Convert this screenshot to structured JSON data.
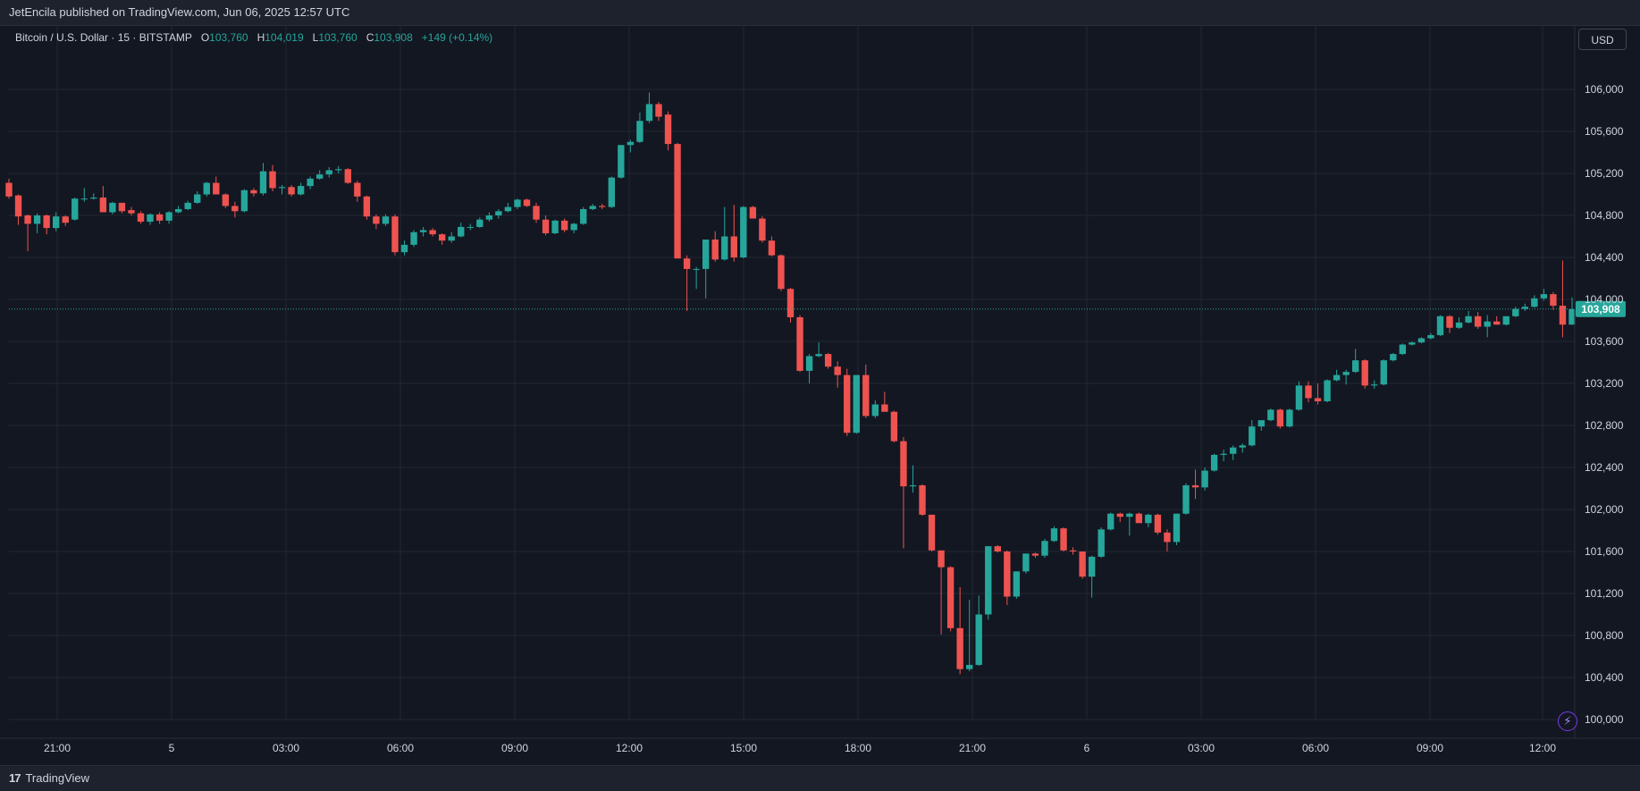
{
  "header": {
    "published": "JetEncila published on TradingView.com, Jun 06, 2025 12:57 UTC"
  },
  "legend": {
    "symbol": "Bitcoin / U.S. Dollar · 15 · BITSTAMP",
    "o_label": "O",
    "o_value": "103,760",
    "h_label": "H",
    "h_value": "104,019",
    "l_label": "L",
    "l_value": "103,760",
    "c_label": "C",
    "c_value": "103,908",
    "change": "+149 (+0.14%)"
  },
  "currency_button": "USD",
  "footer": {
    "brand": "TradingView",
    "logo_icon": "tradingview-logo-icon"
  },
  "colors": {
    "up": "#26a69a",
    "down": "#ef5350",
    "background": "#131722",
    "grid": "#232733"
  },
  "chart_data": {
    "type": "candlestick",
    "symbol": "BTCUSD",
    "interval_minutes": 15,
    "y_ticks": [
      100000,
      100400,
      100800,
      101200,
      101600,
      102000,
      102400,
      102800,
      103200,
      103600,
      104000,
      104400,
      104800,
      105200,
      105600,
      106000
    ],
    "y_tick_labels": [
      "100,000",
      "100,400",
      "100,800",
      "101,200",
      "101,600",
      "102,000",
      "102,400",
      "102,800",
      "103,200",
      "103,600",
      "104,000",
      "104,400",
      "104,800",
      "105,200",
      "105,600",
      "106,000"
    ],
    "x_tick_labels": [
      "21:00",
      "5",
      "03:00",
      "06:00",
      "09:00",
      "12:00",
      "15:00",
      "18:00",
      "21:00",
      "6",
      "03:00",
      "06:00",
      "09:00",
      "12:00"
    ],
    "last_price": 103908,
    "last_price_label": "103,908",
    "ylim": [
      99900,
      106300
    ],
    "candles": [
      {
        "o": 105110,
        "h": 105150,
        "l": 104960,
        "c": 104980
      },
      {
        "o": 104990,
        "h": 105000,
        "l": 104710,
        "c": 104790
      },
      {
        "o": 104800,
        "h": 104810,
        "l": 104460,
        "c": 104720
      },
      {
        "o": 104720,
        "h": 104820,
        "l": 104630,
        "c": 104800
      },
      {
        "o": 104800,
        "h": 104810,
        "l": 104620,
        "c": 104680
      },
      {
        "o": 104680,
        "h": 104830,
        "l": 104650,
        "c": 104790
      },
      {
        "o": 104790,
        "h": 104800,
        "l": 104700,
        "c": 104730
      },
      {
        "o": 104760,
        "h": 104970,
        "l": 104750,
        "c": 104960
      },
      {
        "o": 104960,
        "h": 105060,
        "l": 104930,
        "c": 104960
      },
      {
        "o": 104960,
        "h": 105010,
        "l": 104950,
        "c": 104970
      },
      {
        "o": 104970,
        "h": 105080,
        "l": 104830,
        "c": 104830
      },
      {
        "o": 104830,
        "h": 104930,
        "l": 104810,
        "c": 104920
      },
      {
        "o": 104920,
        "h": 104920,
        "l": 104820,
        "c": 104840
      },
      {
        "o": 104850,
        "h": 104880,
        "l": 104800,
        "c": 104820
      },
      {
        "o": 104820,
        "h": 104840,
        "l": 104720,
        "c": 104740
      },
      {
        "o": 104740,
        "h": 104820,
        "l": 104710,
        "c": 104810
      },
      {
        "o": 104810,
        "h": 104830,
        "l": 104720,
        "c": 104750
      },
      {
        "o": 104750,
        "h": 104840,
        "l": 104720,
        "c": 104830
      },
      {
        "o": 104830,
        "h": 104890,
        "l": 104820,
        "c": 104860
      },
      {
        "o": 104860,
        "h": 104940,
        "l": 104850,
        "c": 104920
      },
      {
        "o": 104920,
        "h": 105030,
        "l": 104910,
        "c": 105000
      },
      {
        "o": 105000,
        "h": 105120,
        "l": 104980,
        "c": 105110
      },
      {
        "o": 105110,
        "h": 105170,
        "l": 105000,
        "c": 105000
      },
      {
        "o": 105000,
        "h": 105010,
        "l": 104870,
        "c": 104890
      },
      {
        "o": 104890,
        "h": 104930,
        "l": 104780,
        "c": 104840
      },
      {
        "o": 104840,
        "h": 105050,
        "l": 104830,
        "c": 105040
      },
      {
        "o": 105040,
        "h": 105060,
        "l": 104980,
        "c": 105010
      },
      {
        "o": 105010,
        "h": 105300,
        "l": 104990,
        "c": 105220
      },
      {
        "o": 105220,
        "h": 105280,
        "l": 105030,
        "c": 105060
      },
      {
        "o": 105060,
        "h": 105090,
        "l": 105000,
        "c": 105070
      },
      {
        "o": 105070,
        "h": 105090,
        "l": 104980,
        "c": 105000
      },
      {
        "o": 105000,
        "h": 105110,
        "l": 104990,
        "c": 105080
      },
      {
        "o": 105080,
        "h": 105170,
        "l": 105050,
        "c": 105150
      },
      {
        "o": 105150,
        "h": 105230,
        "l": 105140,
        "c": 105190
      },
      {
        "o": 105190,
        "h": 105260,
        "l": 105160,
        "c": 105230
      },
      {
        "o": 105230,
        "h": 105270,
        "l": 105200,
        "c": 105240
      },
      {
        "o": 105240,
        "h": 105250,
        "l": 105100,
        "c": 105110
      },
      {
        "o": 105110,
        "h": 105130,
        "l": 104930,
        "c": 104980
      },
      {
        "o": 104980,
        "h": 104990,
        "l": 104760,
        "c": 104790
      },
      {
        "o": 104790,
        "h": 104810,
        "l": 104670,
        "c": 104720
      },
      {
        "o": 104720,
        "h": 104810,
        "l": 104700,
        "c": 104790
      },
      {
        "o": 104790,
        "h": 104810,
        "l": 104420,
        "c": 104450
      },
      {
        "o": 104450,
        "h": 104560,
        "l": 104420,
        "c": 104520
      },
      {
        "o": 104520,
        "h": 104660,
        "l": 104500,
        "c": 104640
      },
      {
        "o": 104640,
        "h": 104690,
        "l": 104600,
        "c": 104660
      },
      {
        "o": 104660,
        "h": 104680,
        "l": 104600,
        "c": 104620
      },
      {
        "o": 104620,
        "h": 104630,
        "l": 104520,
        "c": 104560
      },
      {
        "o": 104560,
        "h": 104640,
        "l": 104540,
        "c": 104600
      },
      {
        "o": 104600,
        "h": 104730,
        "l": 104590,
        "c": 104690
      },
      {
        "o": 104690,
        "h": 104720,
        "l": 104660,
        "c": 104690
      },
      {
        "o": 104690,
        "h": 104780,
        "l": 104680,
        "c": 104760
      },
      {
        "o": 104760,
        "h": 104830,
        "l": 104740,
        "c": 104800
      },
      {
        "o": 104800,
        "h": 104860,
        "l": 104770,
        "c": 104840
      },
      {
        "o": 104840,
        "h": 104920,
        "l": 104830,
        "c": 104880
      },
      {
        "o": 104880,
        "h": 104960,
        "l": 104860,
        "c": 104950
      },
      {
        "o": 104950,
        "h": 104960,
        "l": 104880,
        "c": 104890
      },
      {
        "o": 104890,
        "h": 104920,
        "l": 104730,
        "c": 104760
      },
      {
        "o": 104760,
        "h": 104800,
        "l": 104610,
        "c": 104630
      },
      {
        "o": 104630,
        "h": 104760,
        "l": 104620,
        "c": 104750
      },
      {
        "o": 104750,
        "h": 104770,
        "l": 104640,
        "c": 104660
      },
      {
        "o": 104660,
        "h": 104730,
        "l": 104630,
        "c": 104720
      },
      {
        "o": 104720,
        "h": 104880,
        "l": 104710,
        "c": 104860
      },
      {
        "o": 104860,
        "h": 104910,
        "l": 104850,
        "c": 104890
      },
      {
        "o": 104890,
        "h": 104910,
        "l": 104860,
        "c": 104880
      },
      {
        "o": 104880,
        "h": 105170,
        "l": 104870,
        "c": 105160
      },
      {
        "o": 105160,
        "h": 105470,
        "l": 105150,
        "c": 105470
      },
      {
        "o": 105470,
        "h": 105520,
        "l": 105400,
        "c": 105500
      },
      {
        "o": 105500,
        "h": 105780,
        "l": 105490,
        "c": 105700
      },
      {
        "o": 105700,
        "h": 105970,
        "l": 105680,
        "c": 105860
      },
      {
        "o": 105860,
        "h": 105880,
        "l": 105700,
        "c": 105740
      },
      {
        "o": 105760,
        "h": 105790,
        "l": 105420,
        "c": 105480
      },
      {
        "o": 105480,
        "h": 105490,
        "l": 104390,
        "c": 104390
      },
      {
        "o": 104390,
        "h": 104420,
        "l": 103890,
        "c": 104290
      },
      {
        "o": 104290,
        "h": 104310,
        "l": 104100,
        "c": 104290
      },
      {
        "o": 104290,
        "h": 104570,
        "l": 104010,
        "c": 104570
      },
      {
        "o": 104570,
        "h": 104650,
        "l": 104360,
        "c": 104380
      },
      {
        "o": 104380,
        "h": 104880,
        "l": 104370,
        "c": 104600
      },
      {
        "o": 104600,
        "h": 104900,
        "l": 104360,
        "c": 104400
      },
      {
        "o": 104400,
        "h": 104890,
        "l": 104390,
        "c": 104880
      },
      {
        "o": 104880,
        "h": 104890,
        "l": 104770,
        "c": 104770
      },
      {
        "o": 104770,
        "h": 104790,
        "l": 104540,
        "c": 104560
      },
      {
        "o": 104560,
        "h": 104600,
        "l": 104410,
        "c": 104420
      },
      {
        "o": 104420,
        "h": 104430,
        "l": 104080,
        "c": 104100
      },
      {
        "o": 104100,
        "h": 104110,
        "l": 103780,
        "c": 103830
      },
      {
        "o": 103830,
        "h": 103850,
        "l": 103310,
        "c": 103320
      },
      {
        "o": 103320,
        "h": 103480,
        "l": 103200,
        "c": 103460
      },
      {
        "o": 103460,
        "h": 103590,
        "l": 103450,
        "c": 103480
      },
      {
        "o": 103480,
        "h": 103490,
        "l": 103340,
        "c": 103360
      },
      {
        "o": 103360,
        "h": 103410,
        "l": 103160,
        "c": 103280
      },
      {
        "o": 103280,
        "h": 103340,
        "l": 102700,
        "c": 102730
      },
      {
        "o": 102730,
        "h": 103280,
        "l": 102720,
        "c": 103280
      },
      {
        "o": 103280,
        "h": 103380,
        "l": 102870,
        "c": 102890
      },
      {
        "o": 102890,
        "h": 103040,
        "l": 102870,
        "c": 103000
      },
      {
        "o": 103000,
        "h": 103120,
        "l": 102930,
        "c": 102930
      },
      {
        "o": 102930,
        "h": 102940,
        "l": 102640,
        "c": 102650
      },
      {
        "o": 102650,
        "h": 102690,
        "l": 101630,
        "c": 102220
      },
      {
        "o": 102220,
        "h": 102420,
        "l": 102160,
        "c": 102230
      },
      {
        "o": 102230,
        "h": 102240,
        "l": 101940,
        "c": 101950
      },
      {
        "o": 101950,
        "h": 101950,
        "l": 101600,
        "c": 101610
      },
      {
        "o": 101610,
        "h": 101610,
        "l": 100810,
        "c": 101450
      },
      {
        "o": 101450,
        "h": 101460,
        "l": 100840,
        "c": 100870
      },
      {
        "o": 100870,
        "h": 101260,
        "l": 100430,
        "c": 100480
      },
      {
        "o": 100480,
        "h": 101140,
        "l": 100460,
        "c": 100520
      },
      {
        "o": 100520,
        "h": 101180,
        "l": 100510,
        "c": 101000
      },
      {
        "o": 101000,
        "h": 101640,
        "l": 100950,
        "c": 101650
      },
      {
        "o": 101650,
        "h": 101660,
        "l": 101590,
        "c": 101600
      },
      {
        "o": 101600,
        "h": 101610,
        "l": 101090,
        "c": 101170
      },
      {
        "o": 101170,
        "h": 101410,
        "l": 101150,
        "c": 101410
      },
      {
        "o": 101410,
        "h": 101580,
        "l": 101390,
        "c": 101580
      },
      {
        "o": 101580,
        "h": 101590,
        "l": 101540,
        "c": 101560
      },
      {
        "o": 101560,
        "h": 101720,
        "l": 101540,
        "c": 101700
      },
      {
        "o": 101700,
        "h": 101840,
        "l": 101690,
        "c": 101820
      },
      {
        "o": 101820,
        "h": 101830,
        "l": 101600,
        "c": 101610
      },
      {
        "o": 101610,
        "h": 101640,
        "l": 101570,
        "c": 101600
      },
      {
        "o": 101600,
        "h": 101600,
        "l": 101340,
        "c": 101360
      },
      {
        "o": 101360,
        "h": 101560,
        "l": 101160,
        "c": 101550
      },
      {
        "o": 101550,
        "h": 101830,
        "l": 101540,
        "c": 101810
      },
      {
        "o": 101810,
        "h": 101970,
        "l": 101800,
        "c": 101960
      },
      {
        "o": 101960,
        "h": 101970,
        "l": 101880,
        "c": 101930
      },
      {
        "o": 101930,
        "h": 101970,
        "l": 101750,
        "c": 101960
      },
      {
        "o": 101960,
        "h": 101970,
        "l": 101870,
        "c": 101870
      },
      {
        "o": 101870,
        "h": 101960,
        "l": 101830,
        "c": 101950
      },
      {
        "o": 101950,
        "h": 101960,
        "l": 101760,
        "c": 101780
      },
      {
        "o": 101780,
        "h": 101810,
        "l": 101600,
        "c": 101690
      },
      {
        "o": 101690,
        "h": 101960,
        "l": 101660,
        "c": 101960
      },
      {
        "o": 101960,
        "h": 102250,
        "l": 101950,
        "c": 102230
      },
      {
        "o": 102230,
        "h": 102380,
        "l": 102100,
        "c": 102210
      },
      {
        "o": 102210,
        "h": 102400,
        "l": 102180,
        "c": 102370
      },
      {
        "o": 102370,
        "h": 102530,
        "l": 102360,
        "c": 102520
      },
      {
        "o": 102520,
        "h": 102570,
        "l": 102460,
        "c": 102530
      },
      {
        "o": 102530,
        "h": 102610,
        "l": 102470,
        "c": 102590
      },
      {
        "o": 102590,
        "h": 102630,
        "l": 102540,
        "c": 102610
      },
      {
        "o": 102610,
        "h": 102850,
        "l": 102600,
        "c": 102790
      },
      {
        "o": 102790,
        "h": 102850,
        "l": 102750,
        "c": 102850
      },
      {
        "o": 102850,
        "h": 102960,
        "l": 102840,
        "c": 102950
      },
      {
        "o": 102950,
        "h": 102960,
        "l": 102770,
        "c": 102790
      },
      {
        "o": 102790,
        "h": 102960,
        "l": 102780,
        "c": 102950
      },
      {
        "o": 102950,
        "h": 103220,
        "l": 102940,
        "c": 103180
      },
      {
        "o": 103180,
        "h": 103220,
        "l": 103020,
        "c": 103060
      },
      {
        "o": 103060,
        "h": 103200,
        "l": 103000,
        "c": 103030
      },
      {
        "o": 103030,
        "h": 103240,
        "l": 103020,
        "c": 103230
      },
      {
        "o": 103230,
        "h": 103330,
        "l": 103220,
        "c": 103280
      },
      {
        "o": 103280,
        "h": 103330,
        "l": 103190,
        "c": 103310
      },
      {
        "o": 103310,
        "h": 103530,
        "l": 103300,
        "c": 103420
      },
      {
        "o": 103420,
        "h": 103430,
        "l": 103150,
        "c": 103180
      },
      {
        "o": 103180,
        "h": 103230,
        "l": 103150,
        "c": 103190
      },
      {
        "o": 103190,
        "h": 103430,
        "l": 103180,
        "c": 103420
      },
      {
        "o": 103420,
        "h": 103490,
        "l": 103410,
        "c": 103480
      },
      {
        "o": 103480,
        "h": 103580,
        "l": 103470,
        "c": 103570
      },
      {
        "o": 103570,
        "h": 103600,
        "l": 103560,
        "c": 103590
      },
      {
        "o": 103590,
        "h": 103640,
        "l": 103580,
        "c": 103630
      },
      {
        "o": 103630,
        "h": 103680,
        "l": 103620,
        "c": 103660
      },
      {
        "o": 103660,
        "h": 103850,
        "l": 103650,
        "c": 103840
      },
      {
        "o": 103840,
        "h": 103850,
        "l": 103680,
        "c": 103730
      },
      {
        "o": 103730,
        "h": 103830,
        "l": 103720,
        "c": 103780
      },
      {
        "o": 103780,
        "h": 103890,
        "l": 103770,
        "c": 103840
      },
      {
        "o": 103840,
        "h": 103880,
        "l": 103720,
        "c": 103740
      },
      {
        "o": 103740,
        "h": 103850,
        "l": 103640,
        "c": 103790
      },
      {
        "o": 103790,
        "h": 103840,
        "l": 103760,
        "c": 103760
      },
      {
        "o": 103760,
        "h": 103840,
        "l": 103750,
        "c": 103840
      },
      {
        "o": 103840,
        "h": 103930,
        "l": 103830,
        "c": 103910
      },
      {
        "o": 103910,
        "h": 103960,
        "l": 103890,
        "c": 103930
      },
      {
        "o": 103930,
        "h": 104040,
        "l": 103920,
        "c": 104010
      },
      {
        "o": 104010,
        "h": 104100,
        "l": 103990,
        "c": 104050
      },
      {
        "o": 104050,
        "h": 104070,
        "l": 103900,
        "c": 103940
      },
      {
        "o": 103940,
        "h": 104370,
        "l": 103640,
        "c": 103760
      },
      {
        "o": 103760,
        "h": 104019,
        "l": 103760,
        "c": 103908
      }
    ]
  }
}
